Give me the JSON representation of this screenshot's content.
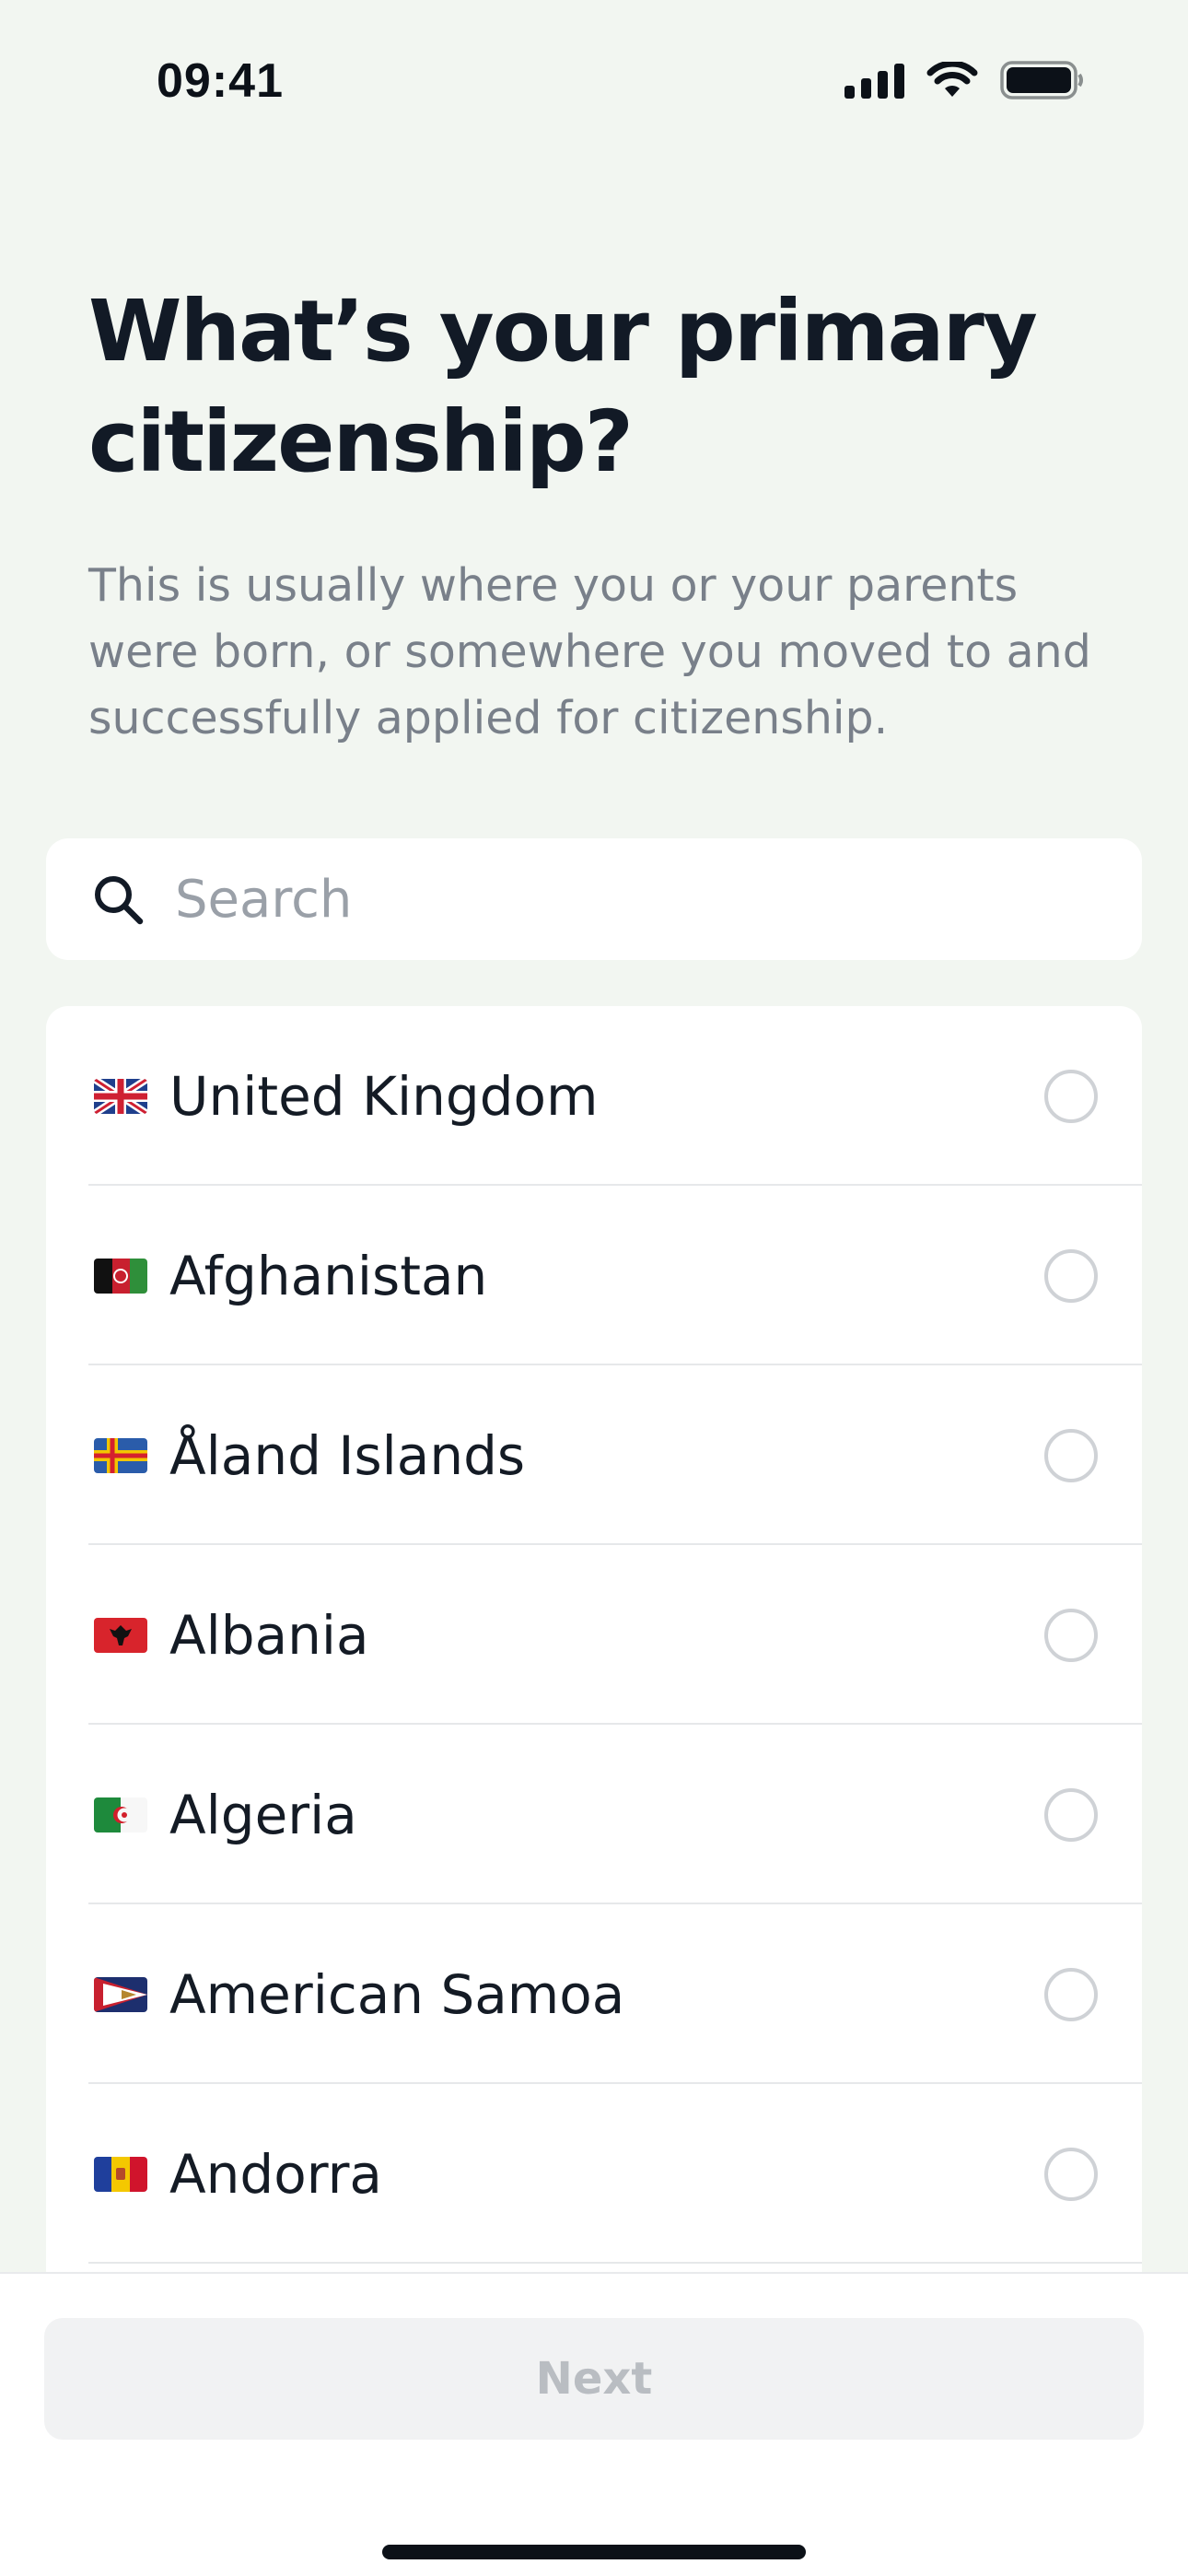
{
  "status_bar": {
    "time": "09:41",
    "icons": [
      "signal-icon",
      "wifi-icon",
      "battery-icon"
    ]
  },
  "header": {
    "title": "What’s your primary citizenship?",
    "subtitle": "This is usually where you or your parents were born, or somewhere you moved to and successfully applied for citizenship."
  },
  "search": {
    "placeholder": "Search",
    "value": "",
    "icon": "search-icon"
  },
  "countries": [
    {
      "name": "United Kingdom",
      "flag_icon": "flag-gb-icon",
      "selected": false
    },
    {
      "name": "Afghanistan",
      "flag_icon": "flag-af-icon",
      "selected": false
    },
    {
      "name": "Åland Islands",
      "flag_icon": "flag-ax-icon",
      "selected": false
    },
    {
      "name": "Albania",
      "flag_icon": "flag-al-icon",
      "selected": false
    },
    {
      "name": "Algeria",
      "flag_icon": "flag-dz-icon",
      "selected": false
    },
    {
      "name": "American Samoa",
      "flag_icon": "flag-as-icon",
      "selected": false
    },
    {
      "name": "Andorra",
      "flag_icon": "flag-ad-icon",
      "selected": false
    }
  ],
  "footer": {
    "next_label": "Next",
    "next_enabled": false
  },
  "colors": {
    "background": "#f2f6f1",
    "card": "#ffffff",
    "title_text": "#121a26",
    "subtitle_text": "#79808a",
    "radio_border": "#cfd2d6",
    "button_disabled_bg": "#f1f2f3",
    "button_disabled_text": "#b9bdc2"
  }
}
